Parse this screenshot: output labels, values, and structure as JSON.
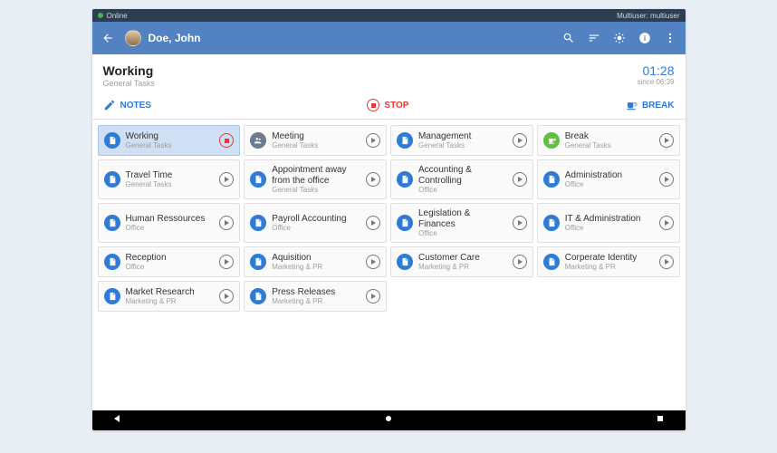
{
  "status": {
    "online": "Online",
    "multiuser": "Multiuser: multiuser"
  },
  "header": {
    "user": "Doe, John"
  },
  "current": {
    "task": "Working",
    "category": "General Tasks",
    "elapsed": "01:28",
    "since": "since 06:39"
  },
  "toolbar": {
    "notes": "NOTES",
    "stop": "STOP",
    "break": "BREAK"
  },
  "icons": {
    "doc": "doc",
    "people": "people",
    "coffee": "coffee"
  },
  "tasks": [
    {
      "title": "Working",
      "category": "General Tasks",
      "icon": "doc",
      "active": true
    },
    {
      "title": "Meeting",
      "category": "General Tasks",
      "icon": "people"
    },
    {
      "title": "Management",
      "category": "General Tasks",
      "icon": "doc"
    },
    {
      "title": "Break",
      "category": "General Tasks",
      "icon": "coffee"
    },
    {
      "title": "Travel Time",
      "category": "General Tasks",
      "icon": "doc"
    },
    {
      "title": "Appointment away from the office",
      "category": "General Tasks",
      "icon": "doc"
    },
    {
      "title": "Accounting & Controlling",
      "category": "Office",
      "icon": "doc"
    },
    {
      "title": "Administration",
      "category": "Office",
      "icon": "doc"
    },
    {
      "title": "Human Ressources",
      "category": "Office",
      "icon": "doc"
    },
    {
      "title": "Payroll Accounting",
      "category": "Office",
      "icon": "doc"
    },
    {
      "title": "Legislation & Finances",
      "category": "Office",
      "icon": "doc"
    },
    {
      "title": "IT & Administration",
      "category": "Office",
      "icon": "doc"
    },
    {
      "title": "Reception",
      "category": "Office",
      "icon": "doc"
    },
    {
      "title": "Aquisition",
      "category": "Marketing & PR",
      "icon": "doc"
    },
    {
      "title": "Customer Care",
      "category": "Marketing & PR",
      "icon": "doc"
    },
    {
      "title": "Corperate Identity",
      "category": "Marketing & PR",
      "icon": "doc"
    },
    {
      "title": "Market Research",
      "category": "Marketing & PR",
      "icon": "doc"
    },
    {
      "title": "Press Releases",
      "category": "Marketing & PR",
      "icon": "doc"
    },
    {
      "title": "",
      "category": "",
      "icon": "",
      "empty": true
    },
    {
      "title": "",
      "category": "",
      "icon": "",
      "empty": true
    }
  ]
}
